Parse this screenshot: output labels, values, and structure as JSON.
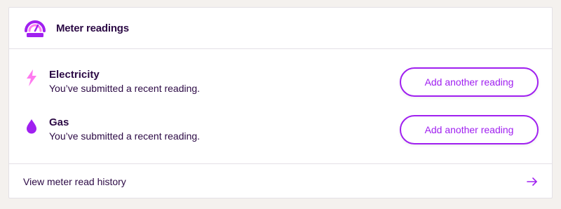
{
  "card": {
    "title": "Meter readings",
    "icon": "meter-gauge-icon"
  },
  "readings": [
    {
      "name": "Electricity",
      "icon": "lightning-bolt-icon",
      "status": "You’ve submitted a recent reading.",
      "button_label": "Add another reading"
    },
    {
      "name": "Gas",
      "icon": "flame-drop-icon",
      "status": "You’ve submitted a recent reading.",
      "button_label": "Add another reading"
    }
  ],
  "footer": {
    "link_label": "View meter read history",
    "icon": "arrow-right-icon"
  },
  "colors": {
    "accent": "#a020f0",
    "text": "#2c0a45",
    "electricity_icon": "#ff7af0",
    "gas_icon": "#a020f0",
    "background": "#f4f1ee"
  }
}
